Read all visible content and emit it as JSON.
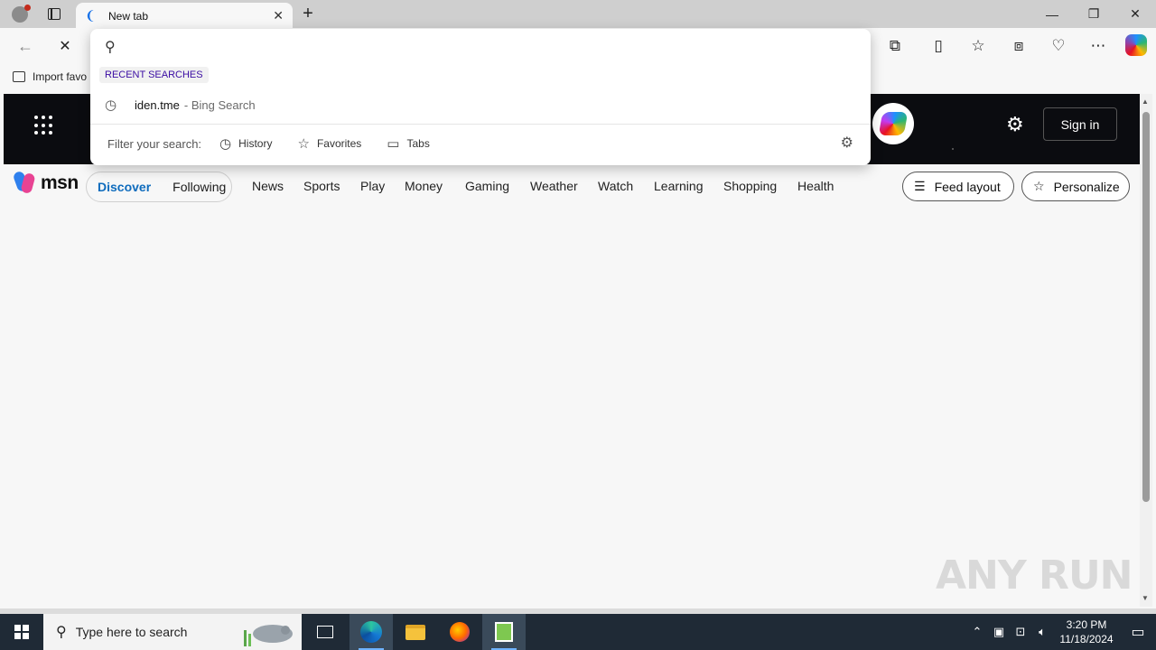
{
  "tab": {
    "title": "New tab",
    "close": "✕"
  },
  "toolbar": {
    "back": "←",
    "stop": "✕",
    "new_tab": "+"
  },
  "window_controls": {
    "minimize": "—",
    "restore": "❐",
    "close": "✕"
  },
  "favorites_bar": {
    "import_label": "Import favo"
  },
  "omnibox": {
    "placeholder": "",
    "recent_label": "RECENT SEARCHES",
    "recent_items": [
      {
        "query": "iden.tme",
        "source": "- Bing Search"
      }
    ],
    "filter_label": "Filter your search:",
    "filters": [
      {
        "label": "History"
      },
      {
        "label": "Favorites"
      },
      {
        "label": "Tabs"
      }
    ]
  },
  "msn": {
    "signin": "Sign in",
    "logo_text": "msn",
    "primary_tabs": [
      {
        "label": "Discover"
      },
      {
        "label": "Following"
      }
    ],
    "nav_links": [
      {
        "label": "News"
      },
      {
        "label": "Sports"
      },
      {
        "label": "Play"
      },
      {
        "label": "Money"
      },
      {
        "label": "Gaming"
      },
      {
        "label": "Weather"
      },
      {
        "label": "Watch"
      },
      {
        "label": "Learning"
      },
      {
        "label": "Shopping"
      },
      {
        "label": "Health"
      }
    ],
    "feed_layout": "Feed layout",
    "personalize": "Personalize"
  },
  "watermark": "ANY RUN",
  "taskbar": {
    "search_placeholder": "Type here to search",
    "time": "3:20 PM",
    "date": "11/18/2024"
  },
  "icons": [
    "profile-icon",
    "tab-actions-icon",
    "search-icon",
    "history-icon",
    "favorites-icon",
    "tabs-icon",
    "settings-icon",
    "extensions-icon",
    "split-screen-icon",
    "collections-icon",
    "browser-essentials-icon",
    "more-icon",
    "copilot-icon"
  ]
}
